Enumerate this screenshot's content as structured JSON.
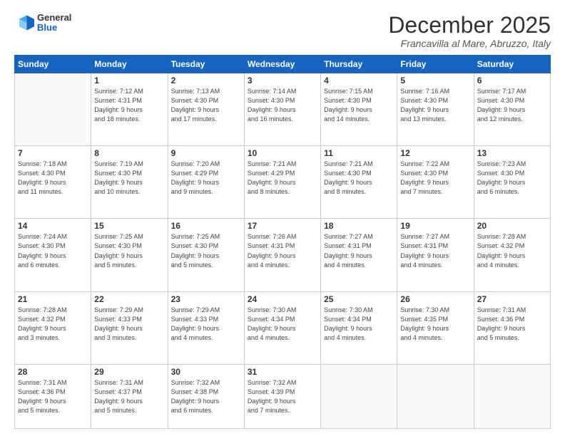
{
  "header": {
    "logo": {
      "general": "General",
      "blue": "Blue"
    },
    "title": "December 2025",
    "subtitle": "Francavilla al Mare, Abruzzo, Italy"
  },
  "weekdays": [
    "Sunday",
    "Monday",
    "Tuesday",
    "Wednesday",
    "Thursday",
    "Friday",
    "Saturday"
  ],
  "weeks": [
    [
      {
        "day": "",
        "info": ""
      },
      {
        "day": "1",
        "info": "Sunrise: 7:12 AM\nSunset: 4:31 PM\nDaylight: 9 hours\nand 18 minutes."
      },
      {
        "day": "2",
        "info": "Sunrise: 7:13 AM\nSunset: 4:30 PM\nDaylight: 9 hours\nand 17 minutes."
      },
      {
        "day": "3",
        "info": "Sunrise: 7:14 AM\nSunset: 4:30 PM\nDaylight: 9 hours\nand 16 minutes."
      },
      {
        "day": "4",
        "info": "Sunrise: 7:15 AM\nSunset: 4:30 PM\nDaylight: 9 hours\nand 14 minutes."
      },
      {
        "day": "5",
        "info": "Sunrise: 7:16 AM\nSunset: 4:30 PM\nDaylight: 9 hours\nand 13 minutes."
      },
      {
        "day": "6",
        "info": "Sunrise: 7:17 AM\nSunset: 4:30 PM\nDaylight: 9 hours\nand 12 minutes."
      }
    ],
    [
      {
        "day": "7",
        "info": "Sunrise: 7:18 AM\nSunset: 4:30 PM\nDaylight: 9 hours\nand 11 minutes."
      },
      {
        "day": "8",
        "info": "Sunrise: 7:19 AM\nSunset: 4:30 PM\nDaylight: 9 hours\nand 10 minutes."
      },
      {
        "day": "9",
        "info": "Sunrise: 7:20 AM\nSunset: 4:29 PM\nDaylight: 9 hours\nand 9 minutes."
      },
      {
        "day": "10",
        "info": "Sunrise: 7:21 AM\nSunset: 4:29 PM\nDaylight: 9 hours\nand 8 minutes."
      },
      {
        "day": "11",
        "info": "Sunrise: 7:21 AM\nSunset: 4:30 PM\nDaylight: 9 hours\nand 8 minutes."
      },
      {
        "day": "12",
        "info": "Sunrise: 7:22 AM\nSunset: 4:30 PM\nDaylight: 9 hours\nand 7 minutes."
      },
      {
        "day": "13",
        "info": "Sunrise: 7:23 AM\nSunset: 4:30 PM\nDaylight: 9 hours\nand 6 minutes."
      }
    ],
    [
      {
        "day": "14",
        "info": "Sunrise: 7:24 AM\nSunset: 4:30 PM\nDaylight: 9 hours\nand 6 minutes."
      },
      {
        "day": "15",
        "info": "Sunrise: 7:25 AM\nSunset: 4:30 PM\nDaylight: 9 hours\nand 5 minutes."
      },
      {
        "day": "16",
        "info": "Sunrise: 7:25 AM\nSunset: 4:30 PM\nDaylight: 9 hours\nand 5 minutes."
      },
      {
        "day": "17",
        "info": "Sunrise: 7:26 AM\nSunset: 4:31 PM\nDaylight: 9 hours\nand 4 minutes."
      },
      {
        "day": "18",
        "info": "Sunrise: 7:27 AM\nSunset: 4:31 PM\nDaylight: 9 hours\nand 4 minutes."
      },
      {
        "day": "19",
        "info": "Sunrise: 7:27 AM\nSunset: 4:31 PM\nDaylight: 9 hours\nand 4 minutes."
      },
      {
        "day": "20",
        "info": "Sunrise: 7:28 AM\nSunset: 4:32 PM\nDaylight: 9 hours\nand 4 minutes."
      }
    ],
    [
      {
        "day": "21",
        "info": "Sunrise: 7:28 AM\nSunset: 4:32 PM\nDaylight: 9 hours\nand 3 minutes."
      },
      {
        "day": "22",
        "info": "Sunrise: 7:29 AM\nSunset: 4:33 PM\nDaylight: 9 hours\nand 3 minutes."
      },
      {
        "day": "23",
        "info": "Sunrise: 7:29 AM\nSunset: 4:33 PM\nDaylight: 9 hours\nand 4 minutes."
      },
      {
        "day": "24",
        "info": "Sunrise: 7:30 AM\nSunset: 4:34 PM\nDaylight: 9 hours\nand 4 minutes."
      },
      {
        "day": "25",
        "info": "Sunrise: 7:30 AM\nSunset: 4:34 PM\nDaylight: 9 hours\nand 4 minutes."
      },
      {
        "day": "26",
        "info": "Sunrise: 7:30 AM\nSunset: 4:35 PM\nDaylight: 9 hours\nand 4 minutes."
      },
      {
        "day": "27",
        "info": "Sunrise: 7:31 AM\nSunset: 4:36 PM\nDaylight: 9 hours\nand 5 minutes."
      }
    ],
    [
      {
        "day": "28",
        "info": "Sunrise: 7:31 AM\nSunset: 4:36 PM\nDaylight: 9 hours\nand 5 minutes."
      },
      {
        "day": "29",
        "info": "Sunrise: 7:31 AM\nSunset: 4:37 PM\nDaylight: 9 hours\nand 5 minutes."
      },
      {
        "day": "30",
        "info": "Sunrise: 7:32 AM\nSunset: 4:38 PM\nDaylight: 9 hours\nand 6 minutes."
      },
      {
        "day": "31",
        "info": "Sunrise: 7:32 AM\nSunset: 4:39 PM\nDaylight: 9 hours\nand 7 minutes."
      },
      {
        "day": "",
        "info": ""
      },
      {
        "day": "",
        "info": ""
      },
      {
        "day": "",
        "info": ""
      }
    ]
  ]
}
